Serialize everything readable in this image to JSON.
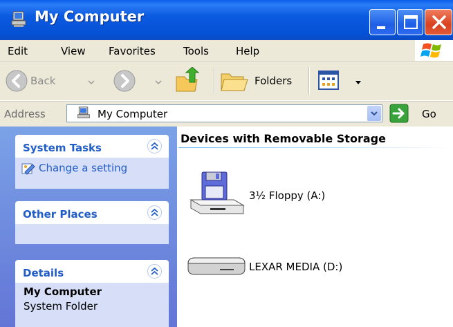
{
  "window": {
    "title": "My Computer"
  },
  "menu": {
    "items": [
      "Edit",
      "View",
      "Favorites",
      "Tools",
      "Help"
    ]
  },
  "toolbar": {
    "back_label": "Back",
    "folders_label": "Folders"
  },
  "address": {
    "label": "Address",
    "value": "My Computer",
    "go_label": "Go"
  },
  "taskpane": {
    "system_tasks": {
      "title": "System Tasks",
      "links": [
        "Change a setting"
      ]
    },
    "other_places": {
      "title": "Other Places"
    },
    "details": {
      "title": "Details",
      "name": "My Computer",
      "type": "System Folder"
    }
  },
  "content": {
    "group_title": "Devices with Removable Storage",
    "devices": [
      {
        "name": "3½ Floppy (A:)",
        "icon": "floppy-drive-icon"
      },
      {
        "name": "LEXAR MEDIA (D:)",
        "icon": "removable-disk-icon"
      }
    ]
  },
  "colors": {
    "titlebar": "#0551d5",
    "taskpane_title": "#215dc6",
    "taskpane_bg": "#6375d6",
    "panel_body": "#d6dff7"
  }
}
